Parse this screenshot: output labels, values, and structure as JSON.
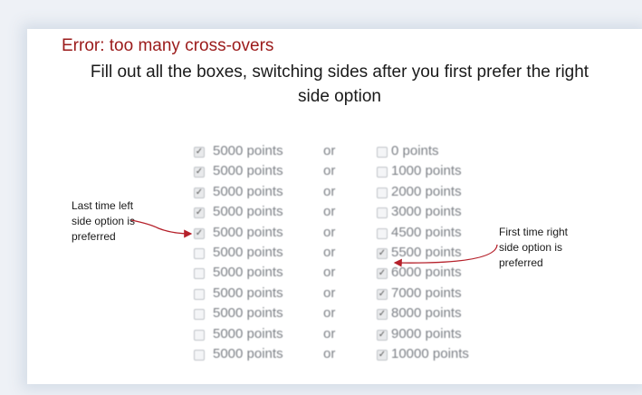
{
  "error_text": "Error: too many cross-overs",
  "instruction_line1": "Fill out all the boxes, switching sides after you first prefer the right",
  "instruction_line2": "side option",
  "separator": "or",
  "rows": [
    {
      "left": "5000 points",
      "right": "0 points",
      "left_checked": true,
      "right_checked": false
    },
    {
      "left": "5000 points",
      "right": "1000 points",
      "left_checked": true,
      "right_checked": false
    },
    {
      "left": "5000 points",
      "right": "2000 points",
      "left_checked": true,
      "right_checked": false
    },
    {
      "left": "5000 points",
      "right": "3000 points",
      "left_checked": true,
      "right_checked": false
    },
    {
      "left": "5000 points",
      "right": "4500 points",
      "left_checked": true,
      "right_checked": false
    },
    {
      "left": "5000 points",
      "right": "5500 points",
      "left_checked": false,
      "right_checked": true
    },
    {
      "left": "5000 points",
      "right": "6000 points",
      "left_checked": false,
      "right_checked": true
    },
    {
      "left": "5000 points",
      "right": "7000 points",
      "left_checked": false,
      "right_checked": true
    },
    {
      "left": "5000 points",
      "right": "8000 points",
      "left_checked": false,
      "right_checked": true
    },
    {
      "left": "5000 points",
      "right": "9000 points",
      "left_checked": false,
      "right_checked": true
    },
    {
      "left": "5000 points",
      "right": "10000 points",
      "left_checked": false,
      "right_checked": true
    }
  ],
  "annotation_left": {
    "line1": "Last time left",
    "line2": "side option is",
    "line3": "preferred"
  },
  "annotation_right": {
    "line1": "First time right",
    "line2": "side option is",
    "line3": "preferred"
  },
  "colors": {
    "error": "#9b1b1b",
    "arrow": "#b5202a",
    "option_text": "#7d8187"
  }
}
